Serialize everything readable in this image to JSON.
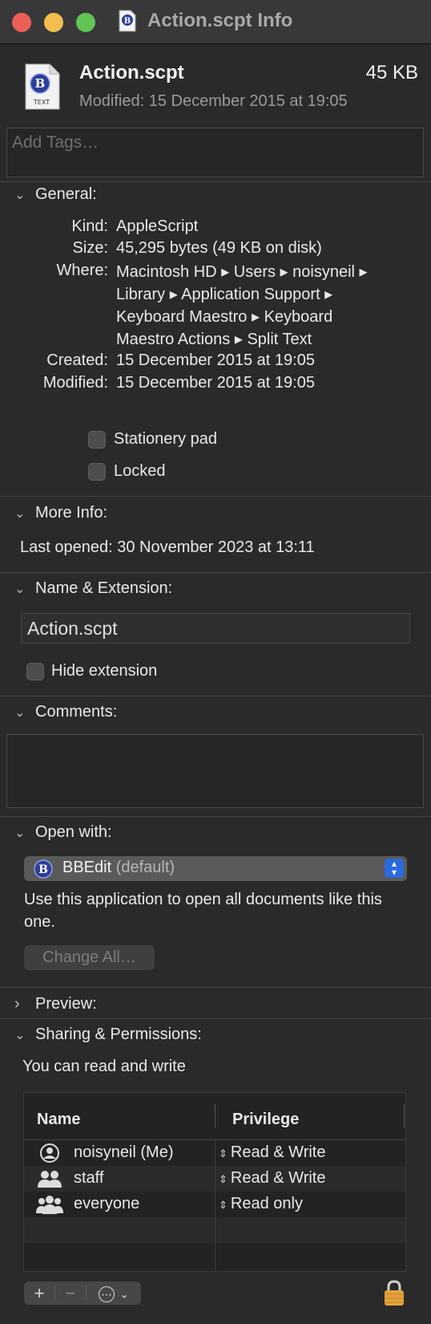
{
  "window": {
    "title": "Action.scpt Info"
  },
  "header": {
    "file_name": "Action.scpt",
    "file_size": "45 KB",
    "modified": "Modified: 15 December 2015 at 19:05",
    "icon_caption": "TEXT"
  },
  "tags": {
    "placeholder": "Add Tags…"
  },
  "general": {
    "heading": "General:",
    "rows": [
      {
        "label": "Kind:",
        "value": "AppleScript"
      },
      {
        "label": "Size:",
        "value": "45,295 bytes (49 KB on disk)"
      },
      {
        "label": "Where:",
        "lines": [
          "Macintosh HD ▸ Users ▸ noisyneil ▸",
          "Library ▸ Application Support ▸",
          "Keyboard Maestro ▸ Keyboard",
          "Maestro Actions ▸ Split Text"
        ]
      },
      {
        "label": "Created:",
        "value": "15 December 2015 at 19:05"
      },
      {
        "label": "Modified:",
        "value": "15 December 2015 at 19:05"
      }
    ],
    "stationery_label": "Stationery pad",
    "locked_label": "Locked"
  },
  "more_info": {
    "heading": "More Info:",
    "last_opened": "Last opened: 30 November 2023 at 13:11"
  },
  "name_ext": {
    "heading": "Name & Extension:",
    "value": "Action.scpt",
    "hide_label": "Hide extension"
  },
  "comments": {
    "heading": "Comments:"
  },
  "open_with": {
    "heading": "Open with:",
    "app": "BBEdit",
    "suffix": "(default)",
    "description": "Use this application to open all documents like this one.",
    "change_all": "Change All…"
  },
  "preview": {
    "heading": "Preview:"
  },
  "sharing": {
    "heading": "Sharing & Permissions:",
    "note": "You can read and write",
    "columns": [
      "Name",
      "Privilege"
    ],
    "rows": [
      {
        "name": "noisyneil (Me)",
        "privilege": "Read & Write",
        "icon": "user-icon"
      },
      {
        "name": "staff",
        "privilege": "Read & Write",
        "icon": "group-icon"
      },
      {
        "name": "everyone",
        "privilege": "Read only",
        "icon": "everyone-icon"
      }
    ],
    "add": "+",
    "remove": "−",
    "action": "⋯"
  },
  "colors": {
    "accent": "#2a6adf",
    "window": "#2a2a2a",
    "lock": "#e3a23a"
  }
}
